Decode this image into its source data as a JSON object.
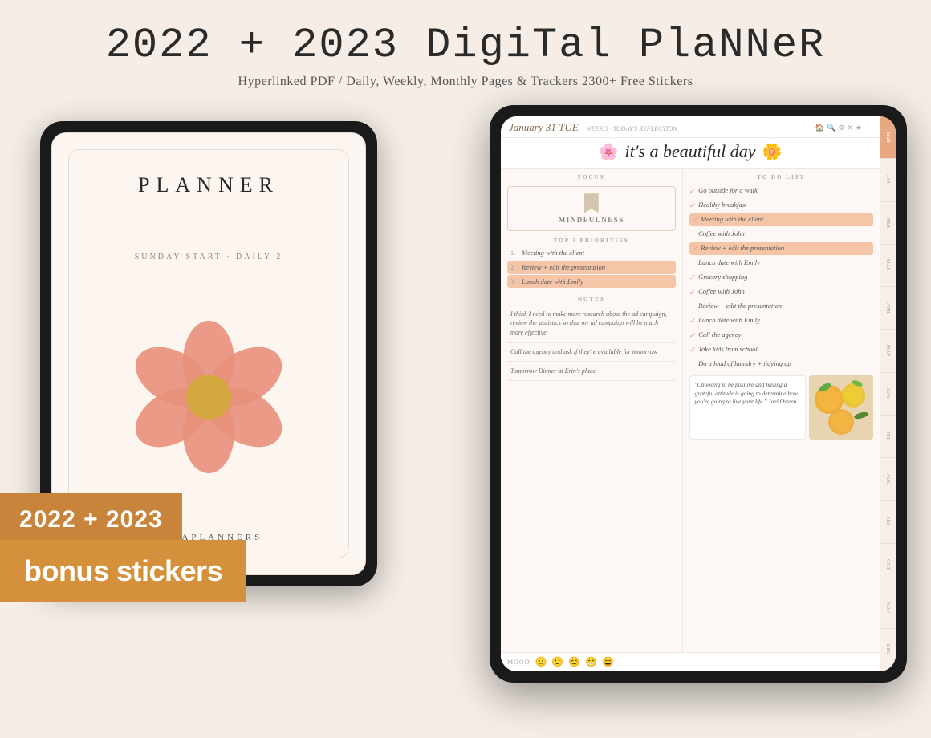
{
  "header": {
    "title": "2022 + 2023 Digital Planner",
    "title_display": "2022 + 2023 DigiTal PlaNNeR",
    "subtitle": "Hyperlinked PDF / Daily, Weekly, Monthly Pages & Trackers 2300+ Free Stickers"
  },
  "left_tablet": {
    "title": "PLANNER",
    "subtitle": "SUNDAY START · DAILY 2",
    "brand": "KAYAPLANNERS"
  },
  "right_tablet": {
    "date": "January 31 TUE",
    "week_label": "WEEK 5 · TODAY'S REFLECTION",
    "tagline": "it's a beautiful day",
    "focus_label": "FOCUS",
    "focus_value": "MINDFULNESS",
    "priorities_label": "TOP 3 PRIORITIES",
    "priorities": [
      {
        "num": "1.",
        "text": "Meeting with the client",
        "highlighted": false
      },
      {
        "num": "2.",
        "text": "Review + edit the presentation",
        "highlighted": true
      },
      {
        "num": "3.",
        "text": "Lunch date with Emily",
        "highlighted": true
      }
    ],
    "notes_label": "NOTES",
    "notes": [
      "I think I need to make more research about the ad campaign, review the statistics so that my ad campaign will be much more effective",
      "Call the agency and ask if they're available for tomorrow",
      "Tomorrow Dinner at Erin's place"
    ],
    "todo_label": "TO DO LIST",
    "todos": [
      {
        "text": "Go outside for a walk",
        "checked": true,
        "highlighted": false
      },
      {
        "text": "Healthy breakfast",
        "checked": true,
        "highlighted": false
      },
      {
        "text": "Meeting with the client",
        "checked": true,
        "highlighted": true
      },
      {
        "text": "Coffee with John",
        "checked": false,
        "highlighted": false
      },
      {
        "text": "Review + edit the presentation",
        "checked": true,
        "highlighted": true
      },
      {
        "text": "Lunch date with Emily",
        "checked": false,
        "highlighted": false
      },
      {
        "text": "Grocery shopping",
        "checked": true,
        "highlighted": false
      },
      {
        "text": "Coffee with John",
        "checked": true,
        "highlighted": false
      },
      {
        "text": "Review + edit the presentation",
        "checked": false,
        "highlighted": false
      },
      {
        "text": "Lunch date with Emily",
        "checked": true,
        "highlighted": false
      },
      {
        "text": "Call the agency",
        "checked": true,
        "highlighted": false
      },
      {
        "text": "Take kids from school",
        "checked": true,
        "highlighted": false
      },
      {
        "text": "Do a load of laundry + tidying up",
        "checked": false,
        "highlighted": false
      }
    ],
    "quote": "\"Choosing to be positive and having a grateful attitude is going to determine how you're going to live your life.\" Joel Osteen",
    "mood_label": "MOOD",
    "tabs": [
      "2023",
      "JAN",
      "FEB",
      "MAR",
      "APR",
      "MAY",
      "JUN",
      "JUL",
      "AUG",
      "SEP",
      "OCT",
      "NOV",
      "DEC"
    ]
  },
  "badges": {
    "year": "2022 + 2023",
    "stickers": "bonus stickers"
  },
  "colors": {
    "background": "#f5ede6",
    "accent_orange": "#c8843a",
    "accent_peach": "#f5c5a8",
    "flower_pink": "#e8907a",
    "flower_center": "#d4a840"
  }
}
